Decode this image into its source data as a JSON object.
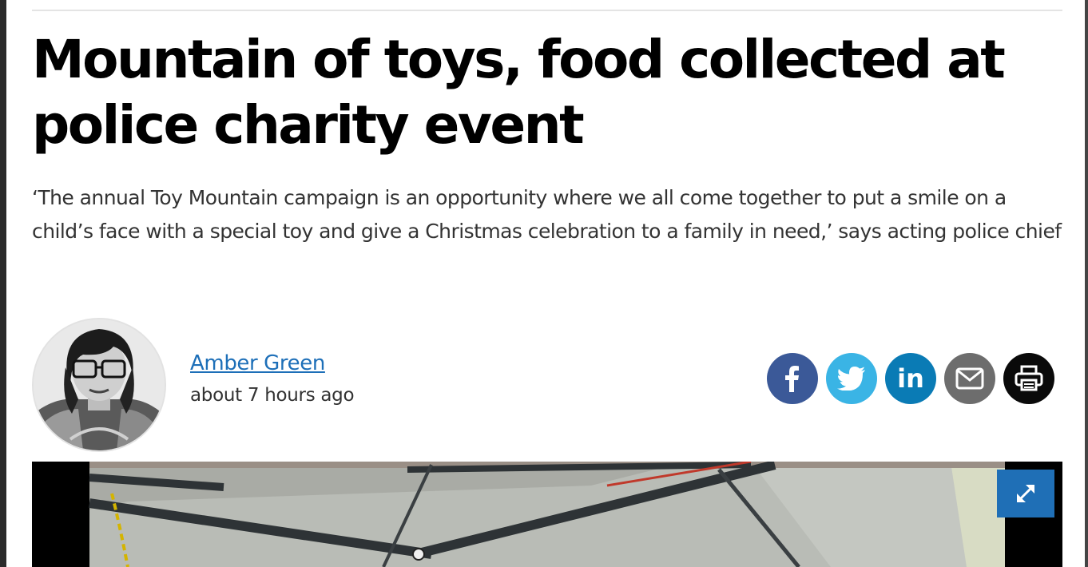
{
  "article": {
    "headline_line1": "Mountain of toys, food collected at",
    "headline_line2": "police charity event",
    "dek": "‘The annual Toy Mountain campaign is an opportunity where we all come together to put a smile on a child’s face with a special toy and give a Christmas celebration to a family in need,’ says acting police chief"
  },
  "byline": {
    "author": "Amber Green",
    "timestamp": "about 7 hours ago"
  },
  "share": {
    "icons": [
      "facebook-icon",
      "twitter-icon",
      "linkedin-icon",
      "email-icon",
      "print-icon"
    ],
    "linkedin_text": "in",
    "colors": {
      "facebook": "#3b5998",
      "twitter": "#3ab4e5",
      "linkedin": "#0a7bb5",
      "email": "#6d6d6d",
      "print": "#0a0a0a"
    }
  },
  "media": {
    "expand_icon": "expand-arrows-icon",
    "button_color": "#1f6fb6"
  },
  "colors": {
    "link": "#1d6fb8",
    "headline": "#000000",
    "body_text": "#333333"
  }
}
